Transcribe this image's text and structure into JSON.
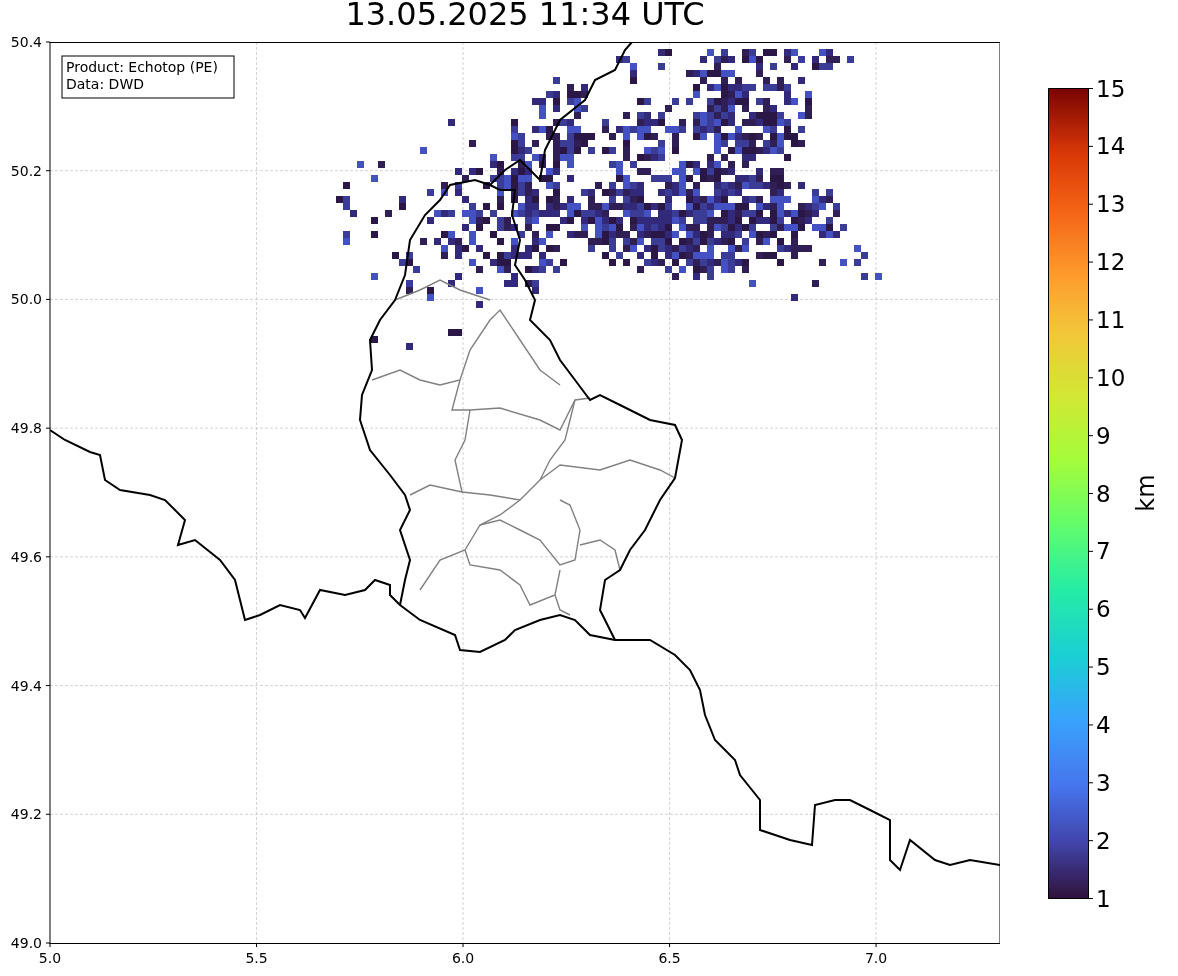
{
  "title": "13.05.2025 11:34 UTC",
  "info_box": {
    "lines": [
      "Product: Echotop (PE)",
      "Data: DWD"
    ]
  },
  "map": {
    "xticks": [
      "5.0",
      "5.5",
      "6.0",
      "6.5",
      "7.0"
    ],
    "yticks": [
      "50.4",
      "50.2",
      "50.0",
      "49.8",
      "49.6",
      "49.4",
      "49.2",
      "49.0"
    ]
  },
  "colorbar": {
    "ticks": [
      "15",
      "14",
      "13",
      "12",
      "11",
      "10",
      "9",
      "8",
      "7",
      "6",
      "5",
      "4",
      "3",
      "2",
      "1"
    ],
    "label": "km"
  }
}
